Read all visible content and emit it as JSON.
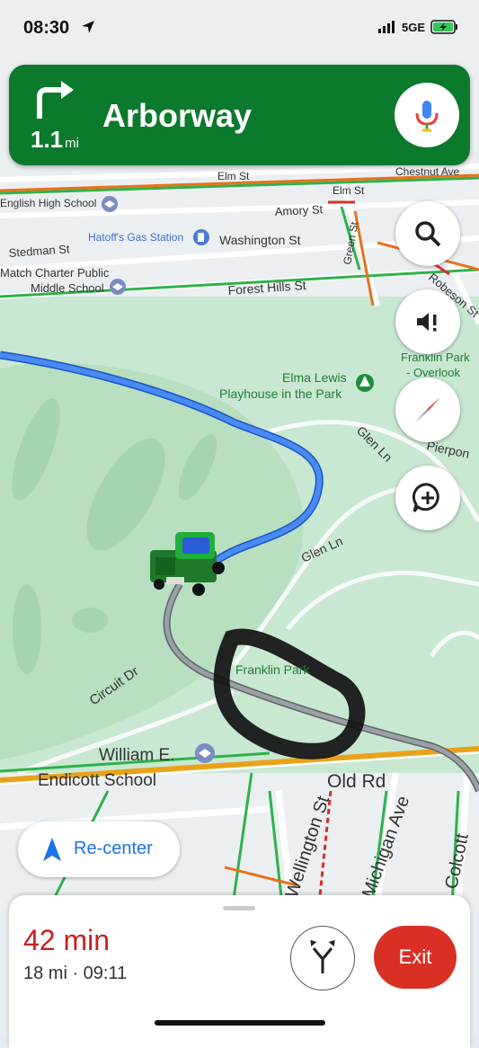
{
  "status_bar": {
    "time": "08:30",
    "network": "5GE"
  },
  "nav_banner": {
    "distance_value": "1.1",
    "distance_unit": "mi",
    "street": "Arborway"
  },
  "map": {
    "labels": {
      "chestnut": "Chestnut Ave",
      "elm_st_1": "Elm St",
      "elm_st_2": "Elm St",
      "amory": "Amory St",
      "english_hs": "English High School",
      "hatoffs": "Hatoff's Gas Station",
      "washington": "Washington St",
      "stedman": "Stedman St",
      "match_charter": "Match Charter Public",
      "middle_school": "Middle School",
      "forest_hills": "Forest Hills St",
      "robeson": "Robeson St",
      "green_st": "Green St",
      "franklin_overlook_1": "Franklin Park",
      "franklin_overlook_2": "- Overlook",
      "elma_1": "Elma Lewis",
      "elma_2": "Playhouse in the Park",
      "glen_ln_1": "Glen Ln",
      "glen_ln_2": "Glen Ln",
      "pierpont": "Pierpon",
      "circuit_dr": "Circuit Dr",
      "franklin_park": "Franklin Park",
      "william_1": "William E.",
      "william_2": "Endicott School",
      "old_rd": "Old Rd",
      "wellington": "Wellington St",
      "michigan": "Michigan Ave",
      "walcott": "Colcott"
    }
  },
  "buttons": {
    "recenter": "Re-center",
    "exit": "Exit"
  },
  "trip": {
    "eta": "42 min",
    "details": "18 mi · 09:11"
  },
  "colors": {
    "banner_green": "#0b7a2c",
    "route_blue": "#1a73e8",
    "exit_red": "#d93025",
    "eta_red": "#c5221f"
  }
}
